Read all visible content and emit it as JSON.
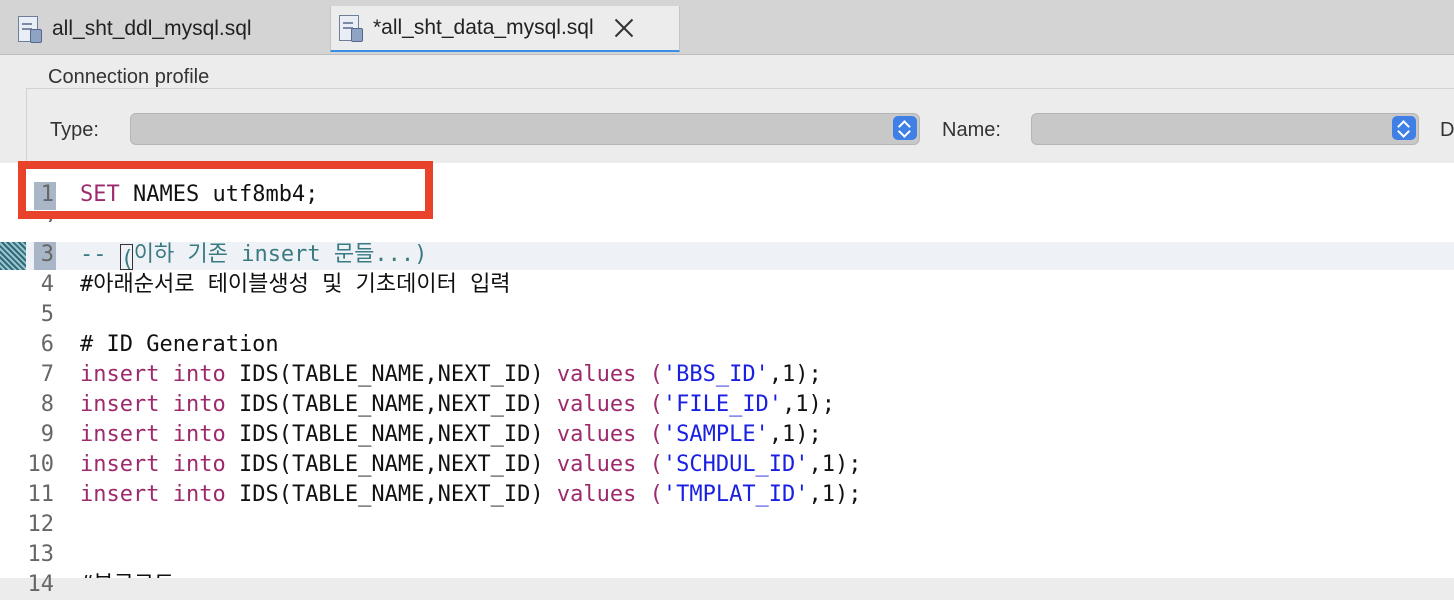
{
  "tabs": [
    {
      "label": "all_sht_ddl_mysql.sql",
      "active": false
    },
    {
      "label": "*all_sht_data_mysql.sql",
      "active": true
    }
  ],
  "connection": {
    "title": "Connection profile",
    "type_label": "Type:",
    "name_label": "Name:",
    "cut_label": "D"
  },
  "colors": {
    "keyword": "#9c2a6c",
    "string": "#1a20e0",
    "comment": "#3a7b82",
    "highlight": "#e8432a"
  },
  "editor": {
    "line_numbers": [
      "1",
      "2",
      "3",
      "4",
      "5",
      "6",
      "7",
      "8",
      "9",
      "10",
      "11",
      "12",
      "13",
      "14"
    ],
    "line1": {
      "kw": "SET",
      "rest": " NAMES utf8mb4;"
    },
    "line3": {
      "pre": "-- ",
      "rest": "이하 기존 insert 문들...)",
      "caret_char": "("
    },
    "line4": "#아래순서로 테이블생성 및 기초데이터 입력",
    "line6": "# ID Generation",
    "inserts": [
      {
        "kw1": "insert",
        "kw2": "into",
        "mid": " IDS(TABLE_NAME,NEXT_ID) ",
        "kw3": "values",
        "open": " (",
        "str": "'BBS_ID'",
        "tail": ",1);"
      },
      {
        "kw1": "insert",
        "kw2": "into",
        "mid": " IDS(TABLE_NAME,NEXT_ID) ",
        "kw3": "values",
        "open": " (",
        "str": "'FILE_ID'",
        "tail": ",1);"
      },
      {
        "kw1": "insert",
        "kw2": "into",
        "mid": " IDS(TABLE_NAME,NEXT_ID) ",
        "kw3": "values",
        "open": " (",
        "str": "'SAMPLE'",
        "tail": ",1);"
      },
      {
        "kw1": "insert",
        "kw2": "into",
        "mid": " IDS(TABLE_NAME,NEXT_ID) ",
        "kw3": "values",
        "open": " (",
        "str": "'SCHDUL_ID'",
        "tail": ",1);"
      },
      {
        "kw1": "insert",
        "kw2": "into",
        "mid": " IDS(TABLE_NAME,NEXT_ID) ",
        "kw3": "values",
        "open": " (",
        "str": "'TMPLAT_ID'",
        "tail": ",1);"
      }
    ],
    "line14": "#부르코드"
  }
}
